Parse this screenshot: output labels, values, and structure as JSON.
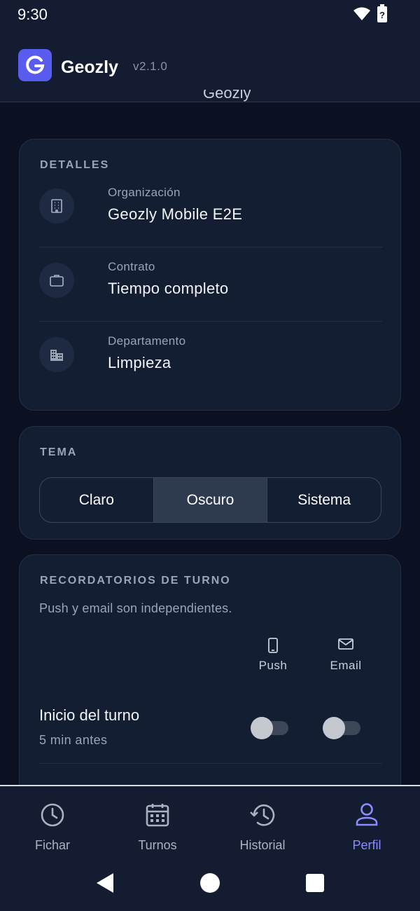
{
  "status_bar": {
    "time": "9:30"
  },
  "app": {
    "title": "Geozly",
    "version": "v2.1.0"
  },
  "peek_text": "Geozly",
  "details": {
    "heading": "DETALLES",
    "rows": [
      {
        "label": "Organización",
        "value": "Geozly Mobile E2E",
        "icon": "building-icon"
      },
      {
        "label": "Contrato",
        "value": "Tiempo completo",
        "icon": "briefcase-icon"
      },
      {
        "label": "Departamento",
        "value": "Limpieza",
        "icon": "department-icon"
      }
    ]
  },
  "theme": {
    "heading": "TEMA",
    "options": [
      "Claro",
      "Oscuro",
      "Sistema"
    ],
    "selected": "Oscuro"
  },
  "reminders": {
    "heading": "RECORDATORIOS DE TURNO",
    "subtitle": "Push y email son independientes.",
    "columns": [
      {
        "label": "Push",
        "icon": "phone-icon"
      },
      {
        "label": "Email",
        "icon": "mail-icon"
      }
    ],
    "items": [
      {
        "title": "Inicio del turno",
        "subtitle": "5 min antes",
        "push": false,
        "email": false
      }
    ]
  },
  "bottom_nav": {
    "items": [
      {
        "label": "Fichar",
        "icon": "clock-icon"
      },
      {
        "label": "Turnos",
        "icon": "calendar-icon"
      },
      {
        "label": "Historial",
        "icon": "history-icon"
      },
      {
        "label": "Perfil",
        "icon": "person-icon"
      }
    ],
    "active": "Perfil"
  },
  "colors": {
    "background": "#0b1120",
    "card": "#141e33",
    "accent": "#5a5cf0",
    "active_nav": "#8b8dff"
  }
}
